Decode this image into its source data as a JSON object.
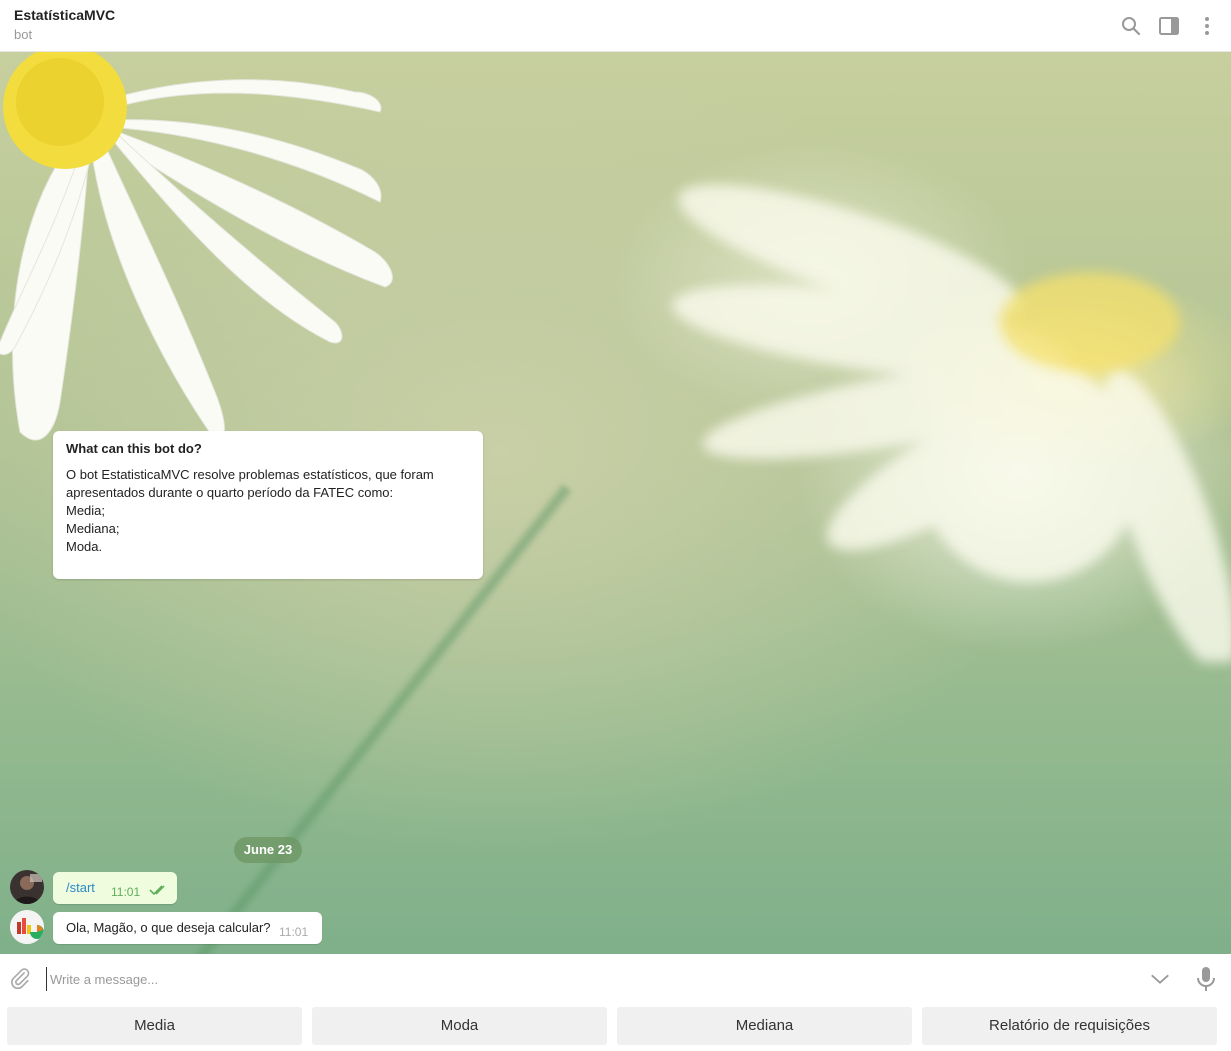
{
  "header": {
    "title": "EstatísticaMVC",
    "subtitle": "bot",
    "icons": [
      "search-icon",
      "sidebar-toggle-icon",
      "more-vertical-icon"
    ]
  },
  "info_card": {
    "title": "What can this bot do?",
    "lines": [
      "O bot EstatisticaMVC resolve problemas estatísticos, que foram",
      "apresentados durante o quarto período da FATEC como:",
      "",
      "Media;",
      "Mediana;",
      "Moda."
    ]
  },
  "date_divider": "June 23",
  "messages": [
    {
      "direction": "out",
      "text": "/start",
      "time": "11:01",
      "status": "read"
    },
    {
      "direction": "in",
      "text": "Ola, Magão, o que deseja calcular?",
      "time": "11:01"
    }
  ],
  "composer": {
    "placeholder": "Write a message...",
    "icons": [
      "attach-icon",
      "chevron-down-icon",
      "microphone-icon"
    ]
  },
  "keyboard": {
    "buttons": [
      "Media",
      "Moda",
      "Mediana",
      "Relatório de requisições"
    ]
  },
  "colors": {
    "outgoing_bubble": "#effdde",
    "link": "#2a8ac7",
    "time_out": "#5fae5b"
  }
}
